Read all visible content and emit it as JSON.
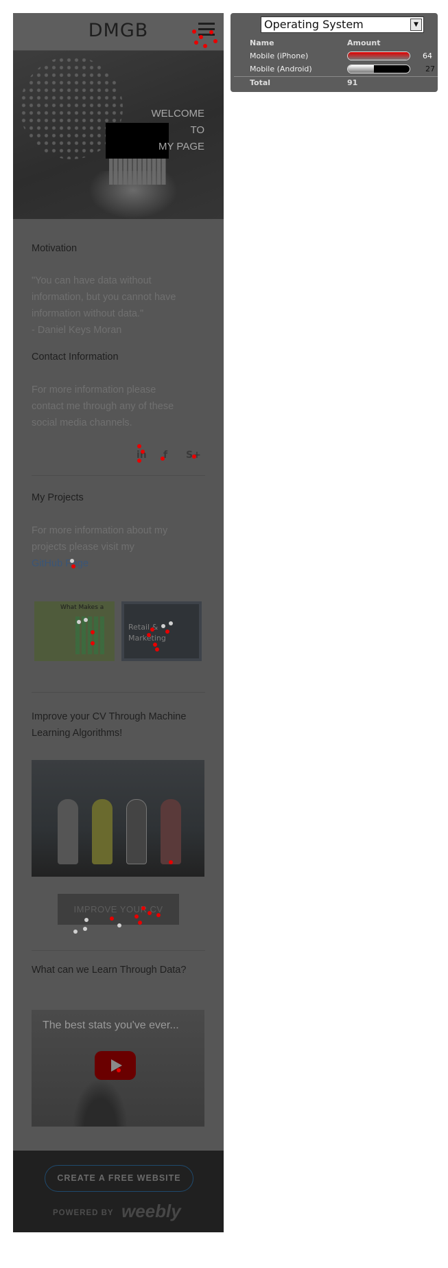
{
  "site": {
    "brand": "DMGB",
    "hero_lines": [
      "WELCOME",
      "TO",
      "MY PAGE"
    ],
    "motivation": {
      "title": "Motivation",
      "quote_lines": [
        "\"You can have data without",
        "information, but you cannot have",
        "information without data.\"",
        "- Daniel Keys Moran"
      ]
    },
    "contact": {
      "title": "Contact Information",
      "text_lines": [
        "For more information please",
        "contact me through any of these",
        "social media channels."
      ],
      "social": [
        "in",
        "f",
        "S+"
      ]
    },
    "projects": {
      "title": "My Projects",
      "text_lines": [
        "For more information about my",
        "projects please visit my"
      ],
      "link": "GitHub Page",
      "thumb1_title": "What Makes a",
      "thumb2_title": "Retail & Marketing"
    },
    "cv": {
      "title_lines": [
        "Improve your CV Through Machine",
        "Learning Algorithms!"
      ],
      "button": "IMPROVE YOUR CV"
    },
    "learn": {
      "title": "What can we Learn Through Data?",
      "video_title": "The best stats you've ever..."
    },
    "footer": {
      "cta": "CREATE A FREE WEBSITE",
      "powered": "POWERED BY",
      "logo": "weebly"
    }
  },
  "panel": {
    "select_value": "Operating System",
    "headers": {
      "name": "Name",
      "amount": "Amount"
    },
    "rows": [
      {
        "name": "Mobile (iPhone)",
        "value": 64,
        "value_text": "64",
        "color": "#e00000"
      },
      {
        "name": "Mobile (Android)",
        "value": 27,
        "value_text": "27",
        "color": "#ffffff"
      }
    ],
    "total_label": "Total",
    "total_value": "91"
  },
  "colors": {
    "overlay_gray": "#565656",
    "accent_red": "#e80000",
    "link_blue": "#3a5577"
  },
  "icons": {
    "menu": "hamburger-icon",
    "select": "dropdown-arrow-icon",
    "play": "play-icon"
  }
}
